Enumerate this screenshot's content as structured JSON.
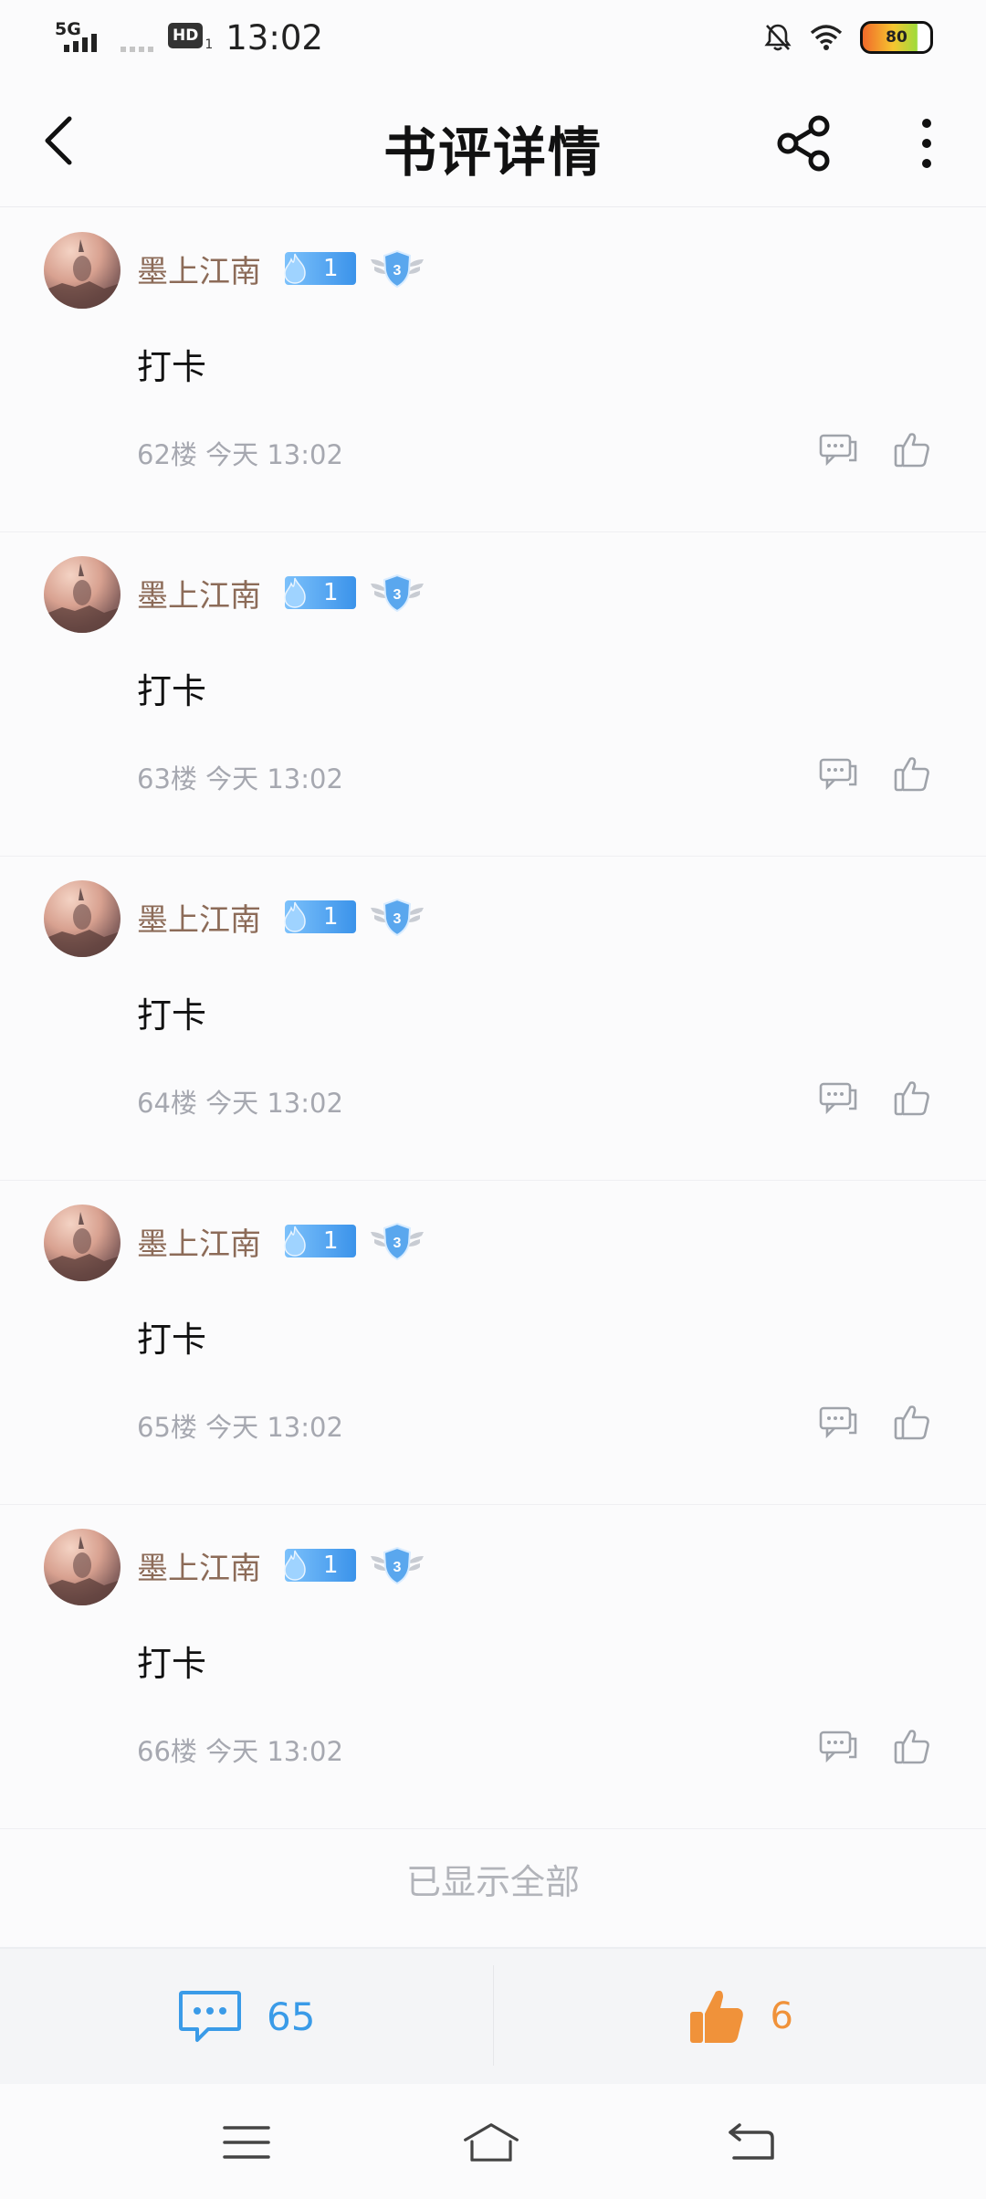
{
  "status": {
    "network": "5G",
    "hd_label": "HD",
    "hd_sub": "1",
    "time": "13:02",
    "battery": "80"
  },
  "header": {
    "title": "书评详情"
  },
  "comments": [
    {
      "username": "墨上江南",
      "level": "1",
      "shield_level": "3",
      "text": "打卡",
      "meta": "62楼 今天 13:02"
    },
    {
      "username": "墨上江南",
      "level": "1",
      "shield_level": "3",
      "text": "打卡",
      "meta": "63楼 今天 13:02"
    },
    {
      "username": "墨上江南",
      "level": "1",
      "shield_level": "3",
      "text": "打卡",
      "meta": "64楼 今天 13:02"
    },
    {
      "username": "墨上江南",
      "level": "1",
      "shield_level": "3",
      "text": "打卡",
      "meta": "65楼 今天 13:02"
    },
    {
      "username": "墨上江南",
      "level": "1",
      "shield_level": "3",
      "text": "打卡",
      "meta": "66楼 今天 13:02"
    }
  ],
  "footer_note": "已显示全部",
  "actions": {
    "comment_count": "65",
    "like_count": "6"
  },
  "colors": {
    "username": "#8c6b58",
    "accent_blue": "#3a9be8",
    "accent_orange": "#f0923a",
    "meta_gray": "#a6a8b0"
  },
  "icons": [
    "back-icon",
    "share-icon",
    "more-icon",
    "reply-icon",
    "thumbs-up-icon",
    "comment-bubble-icon",
    "menu-icon",
    "home-icon",
    "return-icon"
  ]
}
